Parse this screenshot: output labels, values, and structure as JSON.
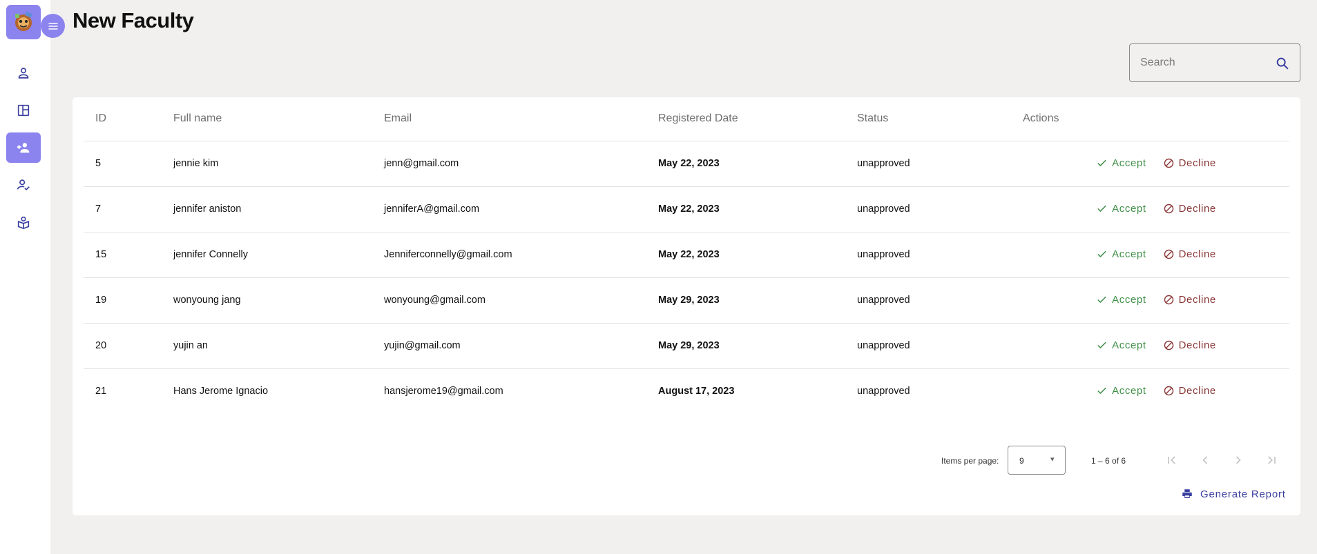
{
  "app": {
    "title": "New Faculty",
    "colors": {
      "accent": "#8b83ee",
      "icon": "#3a3fa0",
      "accept": "#3f8f47",
      "decline": "#8a3535"
    }
  },
  "sidebar": {
    "logo_icon": "mascot-logo",
    "toggle_icon": "menu-icon",
    "items": [
      {
        "icon": "person-icon",
        "active": false
      },
      {
        "icon": "dashboard-icon",
        "active": false
      },
      {
        "icon": "person-add-icon",
        "active": true
      },
      {
        "icon": "person-check-icon",
        "active": false
      },
      {
        "icon": "school-book-icon",
        "active": false
      }
    ]
  },
  "search": {
    "placeholder": "Search",
    "value": ""
  },
  "table": {
    "headers": {
      "id": "ID",
      "full_name": "Full name",
      "email": "Email",
      "registered_date": "Registered Date",
      "status": "Status",
      "actions": "Actions"
    },
    "accept_label": "Accept",
    "decline_label": "Decline",
    "rows": [
      {
        "id": "5",
        "name": "jennie kim",
        "email": "jenn@gmail.com",
        "date": "May 22, 2023",
        "status": "unapproved"
      },
      {
        "id": "7",
        "name": "jennifer aniston",
        "email": "jenniferA@gmail.com",
        "date": "May 22, 2023",
        "status": "unapproved"
      },
      {
        "id": "15",
        "name": "jennifer Connelly",
        "email": "Jenniferconnelly@gmail.com",
        "date": "May 22, 2023",
        "status": "unapproved"
      },
      {
        "id": "19",
        "name": "wonyoung jang",
        "email": "wonyoung@gmail.com",
        "date": "May 29, 2023",
        "status": "unapproved"
      },
      {
        "id": "20",
        "name": "yujin an",
        "email": "yujin@gmail.com",
        "date": "May 29, 2023",
        "status": "unapproved"
      },
      {
        "id": "21",
        "name": "Hans Jerome Ignacio",
        "email": "hansjerome19@gmail.com",
        "date": "August 17, 2023",
        "status": "unapproved"
      }
    ]
  },
  "paginator": {
    "items_per_page_label": "Items per page:",
    "items_per_page_value": "9",
    "range_label": "1 – 6 of 6"
  },
  "report": {
    "label": "Generate Report"
  }
}
